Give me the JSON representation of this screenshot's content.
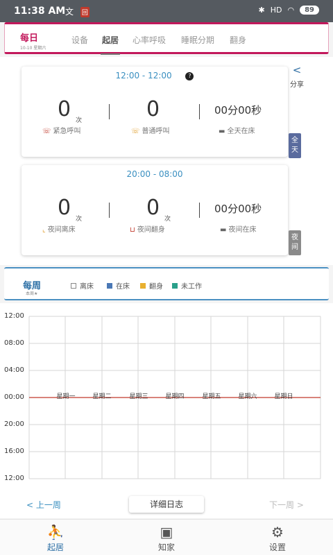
{
  "status_bar": {
    "time": "11:38 AM",
    "app_icon_text": "文",
    "app_badge": "回",
    "signal": "HD",
    "battery": "89"
  },
  "top_bar": {
    "mode_label": "每日",
    "date": "10-10 星期六",
    "tabs": [
      {
        "label": "设备",
        "active": false
      },
      {
        "label": "起居",
        "active": true
      },
      {
        "label": "心率呼吸",
        "active": false
      },
      {
        "label": "睡眠分期",
        "active": false
      },
      {
        "label": "翻身",
        "active": false
      }
    ]
  },
  "share": {
    "label": "分享",
    "icon": "share-icon"
  },
  "day_card": {
    "time_range": "12:00 - 12:00",
    "help": "?",
    "emergency_count": "0",
    "emergency_unit": "次",
    "emergency_label": "紧急呼叫",
    "normal_count": "0",
    "normal_label": "普通呼叫",
    "duration": "00分00秒",
    "duration_label": "全天在床",
    "side_tag": "全天",
    "side_tag_color": "#5a6b9e"
  },
  "night_card": {
    "time_range": "20:00 - 08:00",
    "leave_count": "0",
    "leave_unit": "次",
    "leave_label": "夜间离床",
    "turn_count": "0",
    "turn_unit": "次",
    "turn_label": "夜间翻身",
    "duration": "00分00秒",
    "duration_label": "夜间在床",
    "side_tag": "夜间",
    "side_tag_color": "#8a8a8a"
  },
  "week_bar": {
    "title": "每周",
    "subtitle": "本周★",
    "legend": [
      {
        "label": "离床",
        "color": "#ffffff"
      },
      {
        "label": "在床",
        "color": "#4a78b5"
      },
      {
        "label": "翻身",
        "color": "#e8b030"
      },
      {
        "label": "未工作",
        "color": "#2aa08a"
      }
    ]
  },
  "chart": {
    "y_ticks": [
      "12:00",
      "08:00",
      "04:00",
      "00:00",
      "20:00",
      "16:00",
      "12:00"
    ],
    "days": [
      "星期一",
      "星期二",
      "星期三",
      "星期四",
      "星期五",
      "星期六",
      "星期日"
    ],
    "baseline_color": "#c0392b"
  },
  "nav": {
    "prev": "< 上一周",
    "detail": "详细日志",
    "next": "下一周 >"
  },
  "bottom_nav": [
    {
      "label": "起居",
      "active": true
    },
    {
      "label": "知家",
      "active": false
    },
    {
      "label": "设置",
      "active": false
    }
  ]
}
